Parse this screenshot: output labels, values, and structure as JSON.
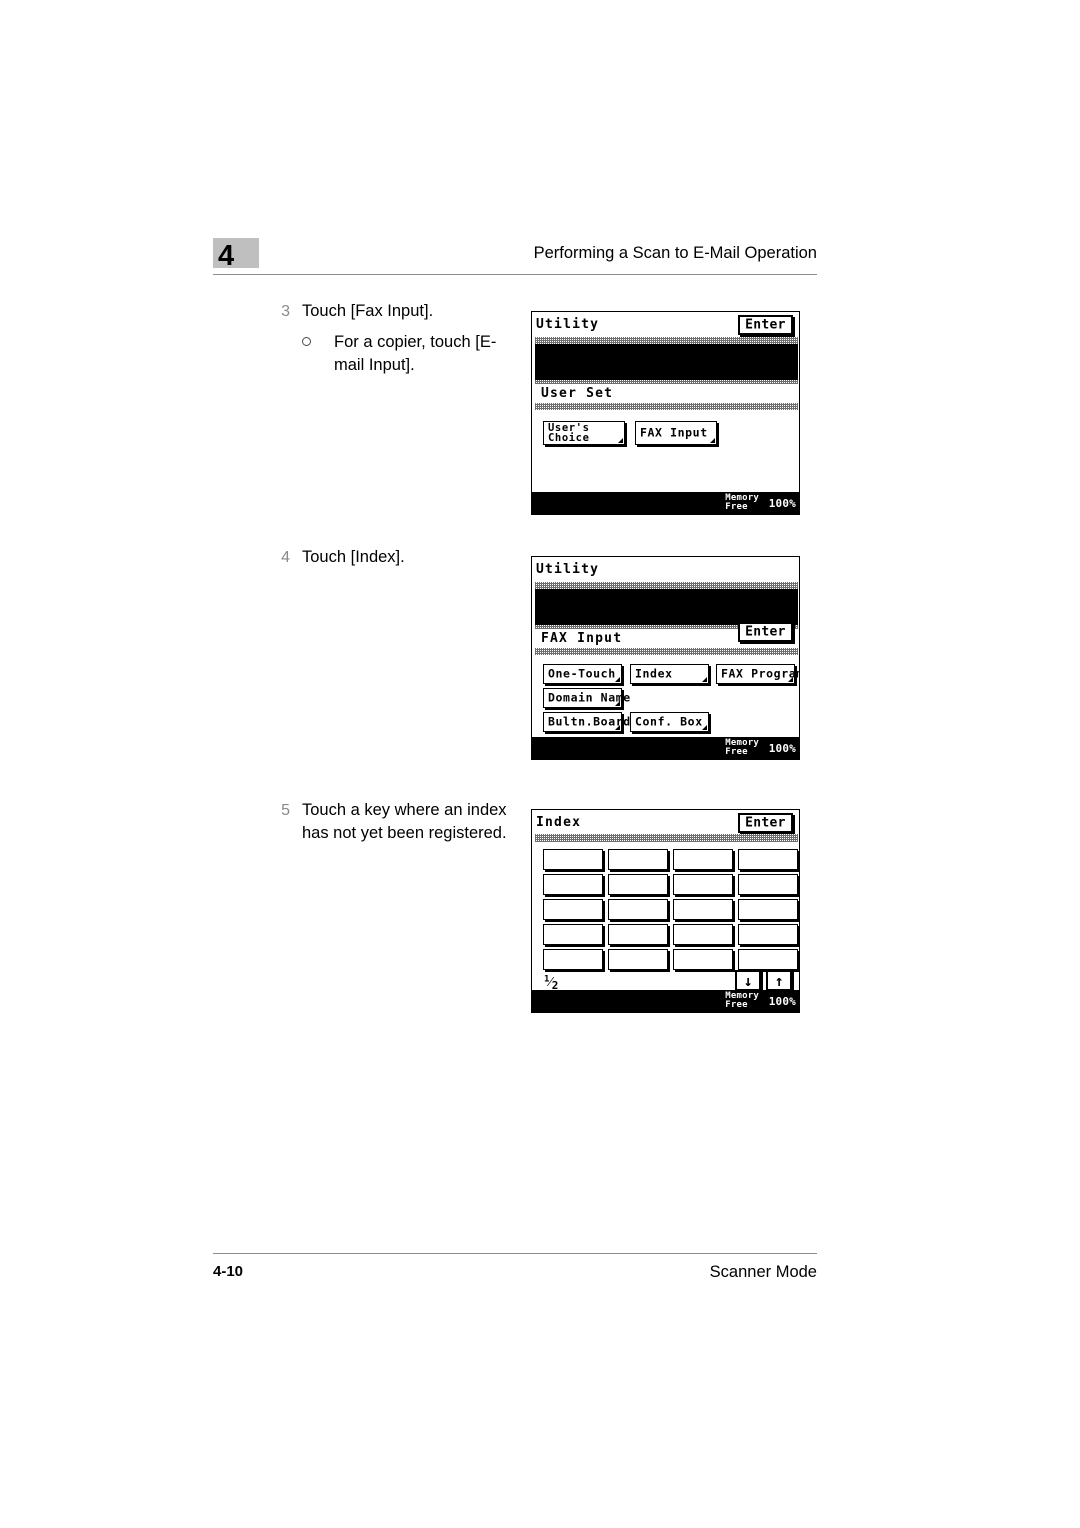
{
  "header": {
    "chapter": "4",
    "title": "Performing a Scan to E-Mail Operation"
  },
  "footer": {
    "page_number": "4-10",
    "section": "Scanner Mode"
  },
  "steps": [
    {
      "number": "3",
      "text": "Touch [Fax Input].",
      "substep": "For a copier, touch [E-mail Input]."
    },
    {
      "number": "4",
      "text": "Touch [Index]."
    },
    {
      "number": "5",
      "text": "Touch a key where an index has not yet been registered."
    }
  ],
  "screens": [
    {
      "title": "Utility",
      "enter_label": "Enter",
      "band_label": "User Set",
      "keys": [
        {
          "label_line1": "User's",
          "label_line2": "Choice"
        },
        {
          "label_line1": "FAX Input"
        }
      ],
      "status": {
        "memory": "Memory",
        "free": "Free",
        "percent": "100%"
      }
    },
    {
      "title": "Utility",
      "enter_label": "Enter",
      "band_label": "FAX Input",
      "keys": [
        {
          "label_line1": "One-Touch"
        },
        {
          "label_line1": "Index"
        },
        {
          "label_line1": "FAX Program"
        },
        {
          "label_line1": "Domain Name"
        },
        {
          "label_line1": "Bultn.Board"
        },
        {
          "label_line1": "Conf. Box"
        }
      ],
      "status": {
        "memory": "Memory",
        "free": "Free",
        "percent": "100%"
      }
    },
    {
      "title": "Index",
      "enter_label": "Enter",
      "page_current": "1",
      "page_total": "2",
      "down_arrow": "↓",
      "up_arrow": "↑",
      "index_key_count": 20,
      "index_key_rows": 5,
      "index_key_cols": 4,
      "status": {
        "memory": "Memory",
        "free": "Free",
        "percent": "100%"
      }
    }
  ]
}
